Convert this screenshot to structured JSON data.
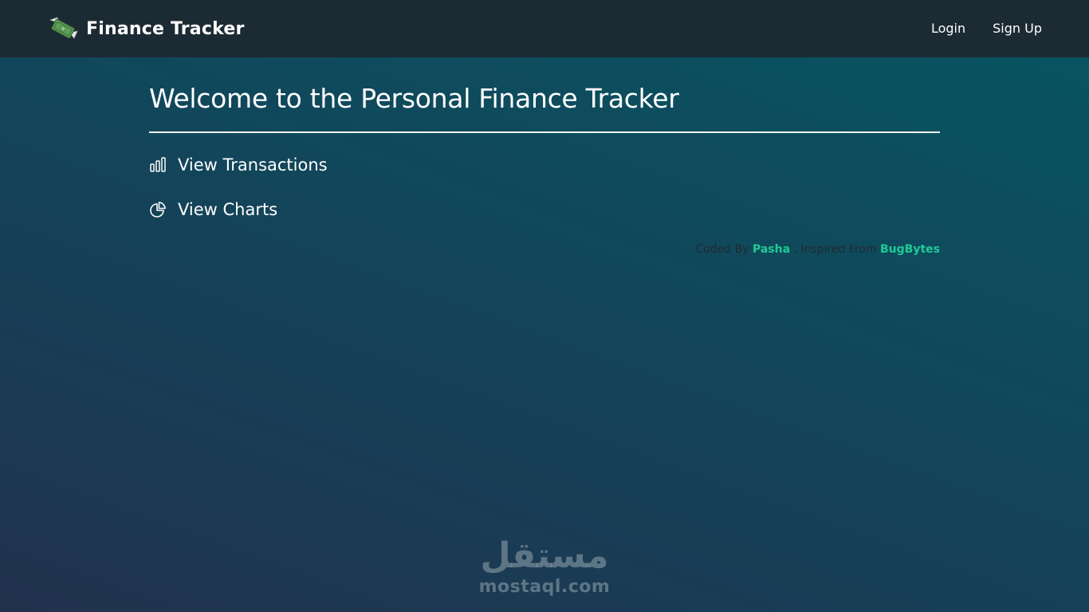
{
  "navbar": {
    "brand_title": "Finance Tracker",
    "brand_icon": "money-with-wings-icon",
    "links": [
      {
        "label": "Login"
      },
      {
        "label": "Sign Up"
      }
    ]
  },
  "main": {
    "title": "Welcome to the Personal Finance Tracker",
    "links": [
      {
        "label": "View Transactions",
        "icon": "bar-chart-icon"
      },
      {
        "label": "View Charts",
        "icon": "pie-chart-icon"
      }
    ],
    "credits": {
      "prefix": "Coded By",
      "author": "Pasha",
      "middle": ", Inspired From",
      "source": "BugBytes"
    }
  },
  "watermark": {
    "arabic": "مستقل",
    "domain": "mostaql.com"
  },
  "colors": {
    "navbar_bg": "#1c2a33",
    "accent": "#20c997",
    "text": "#ffffff",
    "background_top": "#075663",
    "background_bottom": "#22324d"
  }
}
